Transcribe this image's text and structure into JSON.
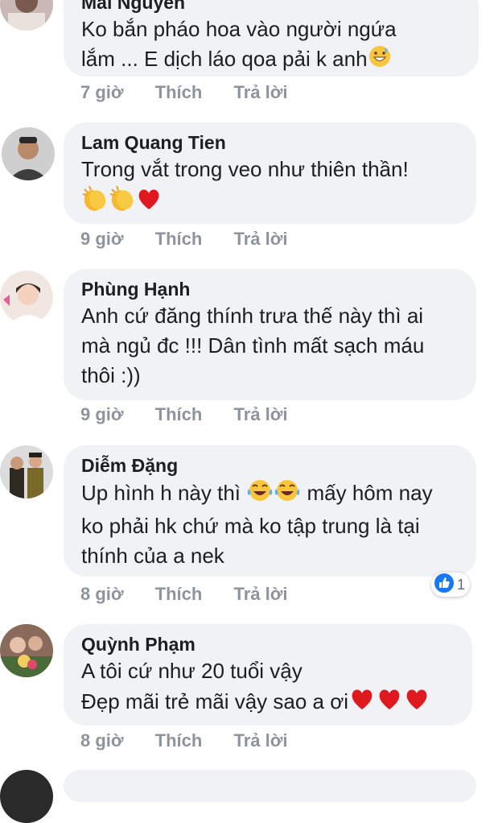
{
  "comments": [
    {
      "name": "Mai Nguyen",
      "lines": [
        "Ko bắn pháo hoa vào người ngứa",
        "lắm  ... E dịch láo qoa pải k anh"
      ],
      "time": "7 giờ"
    },
    {
      "name": "Lam Quang Tien",
      "lines": [
        "Trong vắt trong veo như thiên thần!"
      ],
      "emoji_line": [
        "clapping-hands",
        "clapping-hands",
        "red-heart"
      ],
      "time": "9 giờ"
    },
    {
      "name": "Phùng Hạnh",
      "lines": [
        "Anh cứ đăng thính trưa thế này thì ai",
        "mà ngủ đc !!! Dân tình mất sạch máu",
        "thôi :))"
      ],
      "time": "9 giờ"
    },
    {
      "name": "Diễm Đặng",
      "line1_before": "Up hình h này thì",
      "line1_after": "mấy hôm nay",
      "lines": [
        "ko phải hk chứ mà ko tập trung là tại",
        "thính của a nek"
      ],
      "time": "8 giờ",
      "reaction_count": "1"
    },
    {
      "name": "Quỳnh Phạm",
      "lines": [
        "A tôi cứ như 20 tuổi vậy",
        "Đẹp mãi trẻ mãi vậy sao a ơi"
      ],
      "time": "8 giờ"
    }
  ],
  "actions": {
    "like": "Thích",
    "reply": "Trả lời"
  },
  "colors": {
    "bubble": "#f0f2f5",
    "meta": "#8d949e",
    "like_blue": "#1877f2",
    "heart_red": "#e0181f"
  }
}
